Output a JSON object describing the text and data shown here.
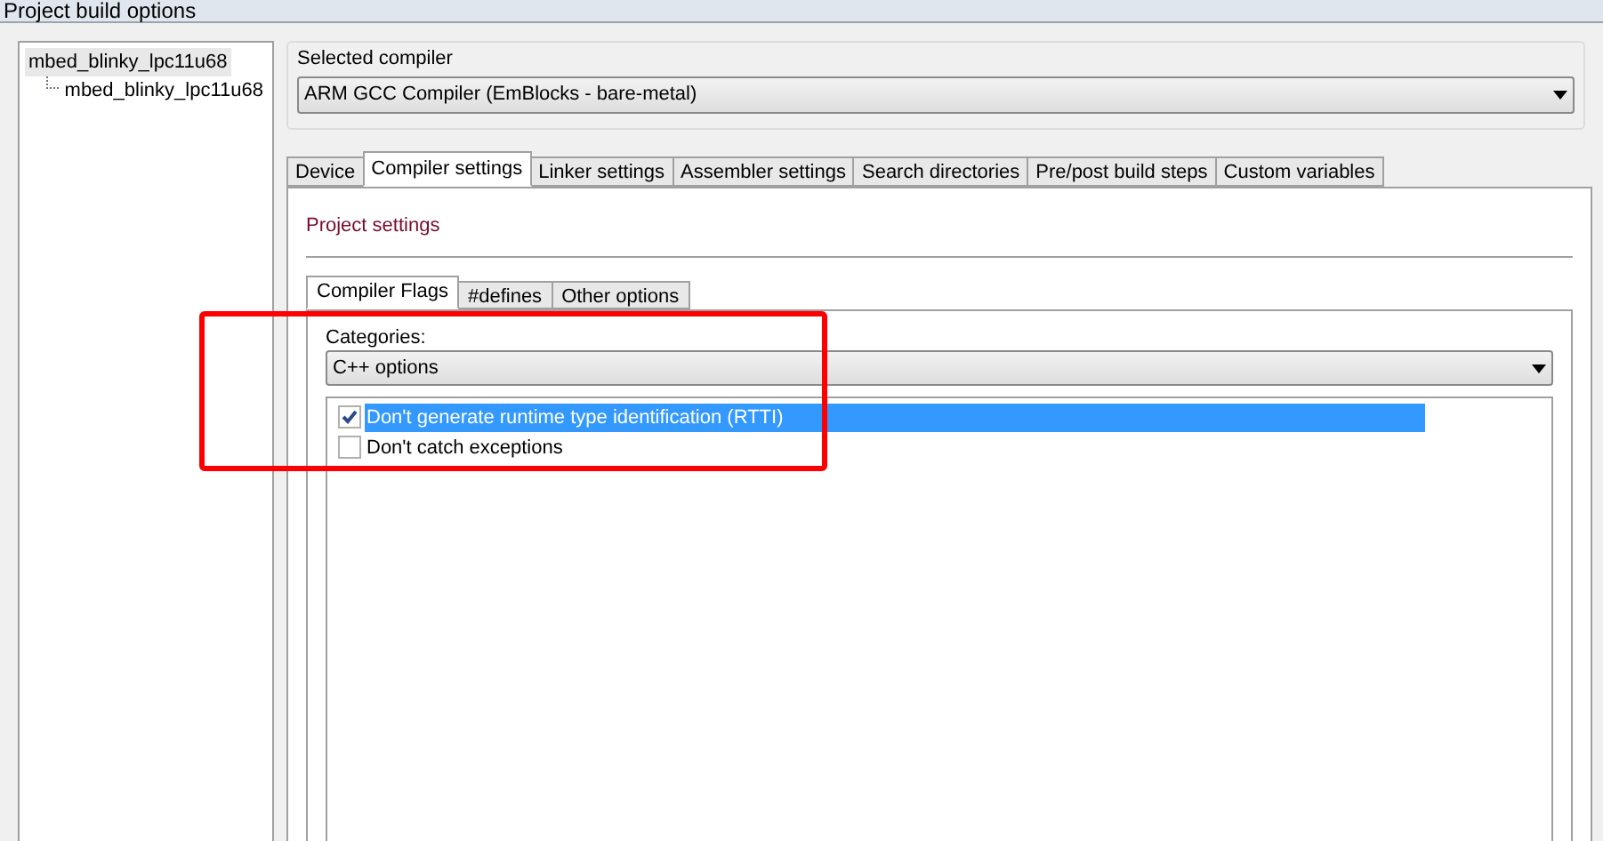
{
  "window": {
    "title": "Project build options"
  },
  "tree": {
    "items": [
      {
        "label": "mbed_blinky_lpc11u68",
        "selected": true,
        "children": [
          {
            "label": "mbed_blinky_lpc11u68",
            "selected": false
          }
        ]
      }
    ]
  },
  "compiler": {
    "label": "Selected compiler",
    "value": "ARM GCC Compiler (EmBlocks - bare-metal)"
  },
  "tabs": [
    {
      "label": "Device",
      "selected": false
    },
    {
      "label": "Compiler settings",
      "selected": true
    },
    {
      "label": "Linker settings",
      "selected": false
    },
    {
      "label": "Assembler settings",
      "selected": false
    },
    {
      "label": "Search directories",
      "selected": false
    },
    {
      "label": "Pre/post build steps",
      "selected": false
    },
    {
      "label": "Custom variables",
      "selected": false
    }
  ],
  "section_title": "Project settings",
  "subtabs": [
    {
      "label": "Compiler Flags",
      "selected": true
    },
    {
      "label": "#defines",
      "selected": false
    },
    {
      "label": "Other options",
      "selected": false
    }
  ],
  "categories": {
    "label": "Categories:",
    "value": "C++ options"
  },
  "options": [
    {
      "label": "Don't generate runtime type identification (RTTI)",
      "checked": true,
      "selected": true
    },
    {
      "label": "Don't catch exceptions",
      "checked": false,
      "selected": false
    }
  ]
}
